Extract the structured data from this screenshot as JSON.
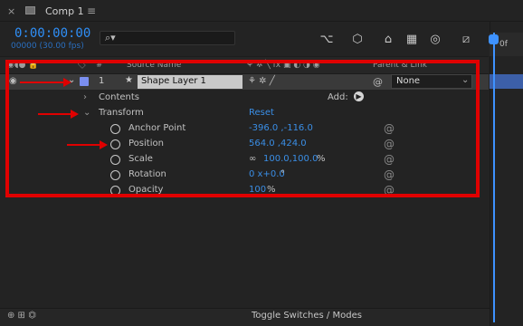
{
  "tab": {
    "close": "×",
    "title": "Comp 1",
    "menu": "≡"
  },
  "timecode": {
    "time": "0:00:00:00",
    "frames": "00000 (30.00 fps)"
  },
  "search": {
    "placeholder": ""
  },
  "toolbar_icons": [
    "draft-3d-icon",
    "solo-icon",
    "shy-icon",
    "frame-blending-icon",
    "motion-blur-icon",
    "graph-editor-icon"
  ],
  "columns": {
    "hash": "#",
    "source_name": "Source Name",
    "parent": "Parent & Link"
  },
  "layer": {
    "number": "1",
    "star": "★",
    "name": "Shape Layer 1",
    "label_color": "#7b8ff0",
    "parent": "None"
  },
  "contents": {
    "label": "Contents",
    "add": "Add:"
  },
  "transform": {
    "label": "Transform",
    "reset": "Reset",
    "props": [
      {
        "name": "Anchor Point",
        "value": "-396.0 ,-116.0",
        "suffix": ""
      },
      {
        "name": "Position",
        "value": "564.0 ,424.0",
        "suffix": ""
      },
      {
        "name": "Scale",
        "value": "100.0,100.0",
        "suffix": "%"
      },
      {
        "name": "Rotation",
        "value": "0 x+0.0",
        "suffix": "°"
      },
      {
        "name": "Opacity",
        "value": "100",
        "suffix": "%"
      }
    ]
  },
  "ruler": {
    "start": "0f"
  },
  "bottom": {
    "toggle": "Toggle Switches / Modes"
  },
  "colors": {
    "accent": "#3a8ee6",
    "annotation": "#e00000"
  }
}
